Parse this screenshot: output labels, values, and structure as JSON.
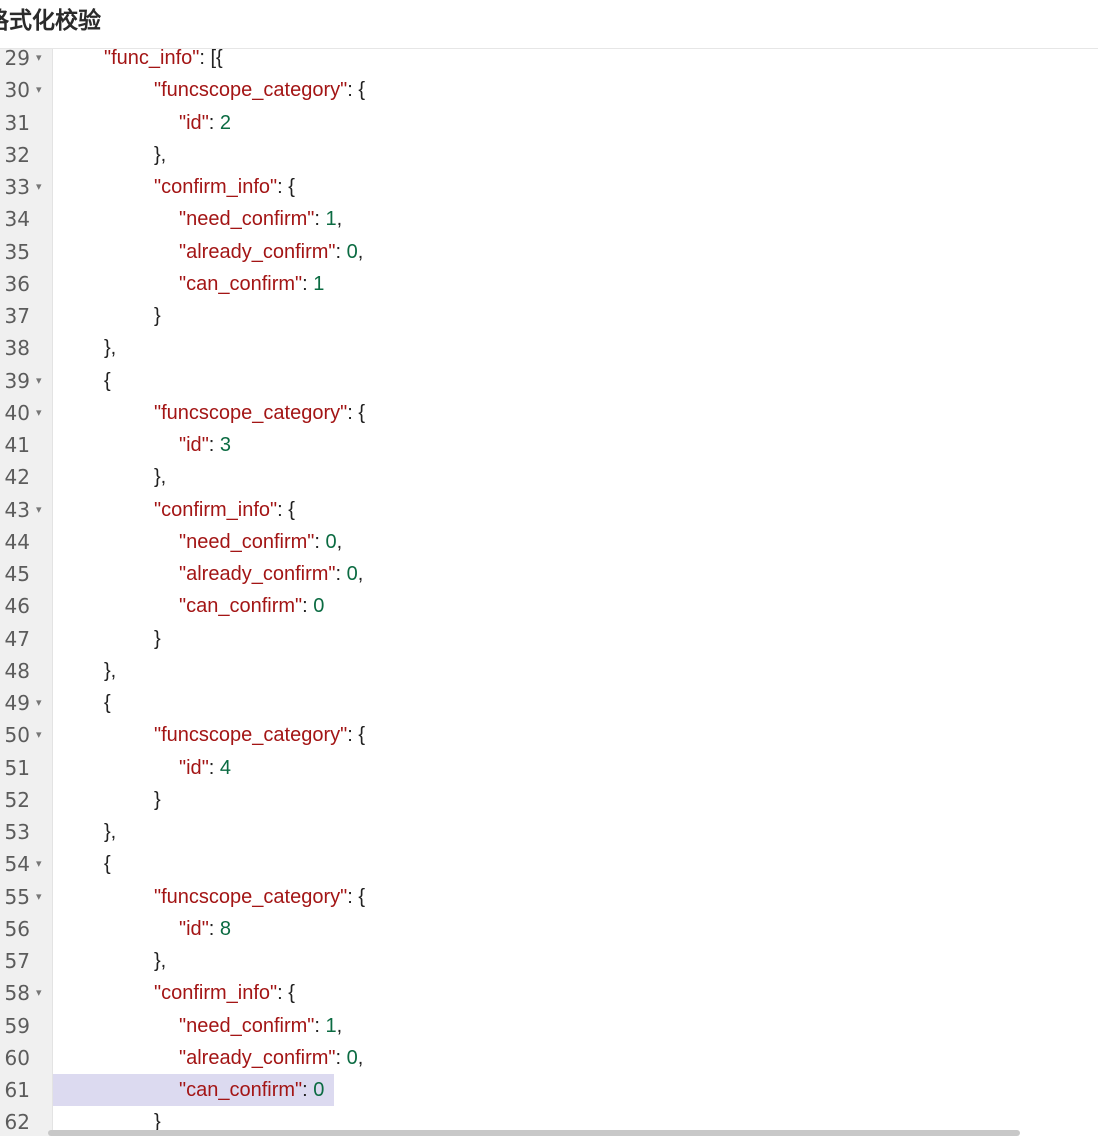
{
  "header": {
    "title": "格式化校验"
  },
  "editor": {
    "lines": [
      {
        "n": "29",
        "fold": true,
        "indent": 1,
        "key": "func_info",
        "tail": ": [{",
        "val": ""
      },
      {
        "n": "30",
        "fold": true,
        "indent": 2,
        "key": "funcscope_category",
        "tail": ": {",
        "val": ""
      },
      {
        "n": "31",
        "fold": false,
        "indent": 3,
        "key": "id",
        "tail": ": ",
        "val": "2"
      },
      {
        "n": "32",
        "fold": false,
        "indent": 2,
        "key": "",
        "tail": "},",
        "val": ""
      },
      {
        "n": "33",
        "fold": true,
        "indent": 2,
        "key": "confirm_info",
        "tail": ": {",
        "val": ""
      },
      {
        "n": "34",
        "fold": false,
        "indent": 3,
        "key": "need_confirm",
        "tail": ": ",
        "val": "1",
        "after": ","
      },
      {
        "n": "35",
        "fold": false,
        "indent": 3,
        "key": "already_confirm",
        "tail": ": ",
        "val": "0",
        "after": ","
      },
      {
        "n": "36",
        "fold": false,
        "indent": 3,
        "key": "can_confirm",
        "tail": ": ",
        "val": "1"
      },
      {
        "n": "37",
        "fold": false,
        "indent": 2,
        "key": "",
        "tail": "}",
        "val": ""
      },
      {
        "n": "38",
        "fold": false,
        "indent": 1,
        "key": "",
        "tail": "},",
        "val": ""
      },
      {
        "n": "39",
        "fold": true,
        "indent": 1,
        "key": "",
        "tail": "{",
        "val": ""
      },
      {
        "n": "40",
        "fold": true,
        "indent": 2,
        "key": "funcscope_category",
        "tail": ": {",
        "val": ""
      },
      {
        "n": "41",
        "fold": false,
        "indent": 3,
        "key": "id",
        "tail": ": ",
        "val": "3"
      },
      {
        "n": "42",
        "fold": false,
        "indent": 2,
        "key": "",
        "tail": "},",
        "val": ""
      },
      {
        "n": "43",
        "fold": true,
        "indent": 2,
        "key": "confirm_info",
        "tail": ": {",
        "val": ""
      },
      {
        "n": "44",
        "fold": false,
        "indent": 3,
        "key": "need_confirm",
        "tail": ": ",
        "val": "0",
        "after": ","
      },
      {
        "n": "45",
        "fold": false,
        "indent": 3,
        "key": "already_confirm",
        "tail": ": ",
        "val": "0",
        "after": ","
      },
      {
        "n": "46",
        "fold": false,
        "indent": 3,
        "key": "can_confirm",
        "tail": ": ",
        "val": "0"
      },
      {
        "n": "47",
        "fold": false,
        "indent": 2,
        "key": "",
        "tail": "}",
        "val": ""
      },
      {
        "n": "48",
        "fold": false,
        "indent": 1,
        "key": "",
        "tail": "},",
        "val": ""
      },
      {
        "n": "49",
        "fold": true,
        "indent": 1,
        "key": "",
        "tail": "{",
        "val": ""
      },
      {
        "n": "50",
        "fold": true,
        "indent": 2,
        "key": "funcscope_category",
        "tail": ": {",
        "val": ""
      },
      {
        "n": "51",
        "fold": false,
        "indent": 3,
        "key": "id",
        "tail": ": ",
        "val": "4"
      },
      {
        "n": "52",
        "fold": false,
        "indent": 2,
        "key": "",
        "tail": "}",
        "val": ""
      },
      {
        "n": "53",
        "fold": false,
        "indent": 1,
        "key": "",
        "tail": "},",
        "val": ""
      },
      {
        "n": "54",
        "fold": true,
        "indent": 1,
        "key": "",
        "tail": "{",
        "val": ""
      },
      {
        "n": "55",
        "fold": true,
        "indent": 2,
        "key": "funcscope_category",
        "tail": ": {",
        "val": ""
      },
      {
        "n": "56",
        "fold": false,
        "indent": 3,
        "key": "id",
        "tail": ": ",
        "val": "8"
      },
      {
        "n": "57",
        "fold": false,
        "indent": 2,
        "key": "",
        "tail": "},",
        "val": ""
      },
      {
        "n": "58",
        "fold": true,
        "indent": 2,
        "key": "confirm_info",
        "tail": ": {",
        "val": ""
      },
      {
        "n": "59",
        "fold": false,
        "indent": 3,
        "key": "need_confirm",
        "tail": ": ",
        "val": "1",
        "after": ","
      },
      {
        "n": "60",
        "fold": false,
        "indent": 3,
        "key": "already_confirm",
        "tail": ": ",
        "val": "0",
        "after": ","
      },
      {
        "n": "61",
        "fold": false,
        "indent": 3,
        "key": "can_confirm",
        "tail": ": ",
        "val": "0",
        "active": true
      },
      {
        "n": "62",
        "fold": false,
        "indent": 2,
        "key": "",
        "tail": "}",
        "val": ""
      }
    ]
  },
  "colors": {
    "key": "#a31515",
    "number": "#0b6b42",
    "active_line": "#dcdaf0",
    "gutter": "#f0f0f0"
  },
  "icons": {
    "fold": "triangle-down-icon"
  }
}
